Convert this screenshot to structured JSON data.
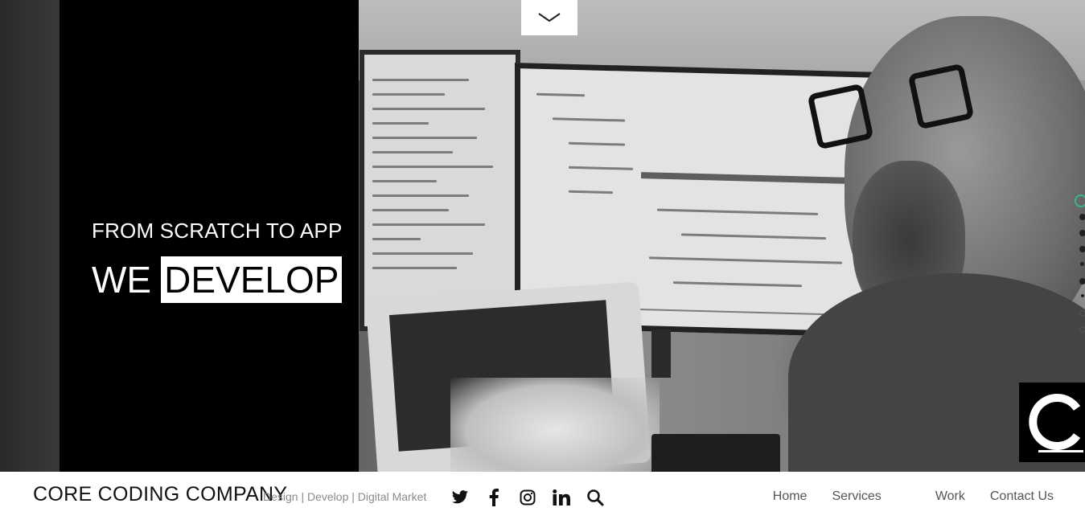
{
  "hero": {
    "subhead": "FROM SCRATCH TO APP",
    "headline_lead": "WE",
    "headline_highlight": "DEVELOP",
    "scroll_icon": "chevron-down-icon",
    "slide_dots_count": 9,
    "active_dot_color": "#3fb58a",
    "corner_logo_icon": "c-logo-icon"
  },
  "header": {
    "brand": "CORE CODING COMPANY",
    "tagline": "Design | Develop | Digital Market",
    "social": [
      {
        "icon": "twitter-icon"
      },
      {
        "icon": "facebook-icon"
      },
      {
        "icon": "instagram-icon"
      },
      {
        "icon": "linkedin-icon"
      },
      {
        "icon": "search-icon"
      }
    ],
    "nav": [
      "Home",
      "Services",
      "Work",
      "Contact Us"
    ]
  }
}
